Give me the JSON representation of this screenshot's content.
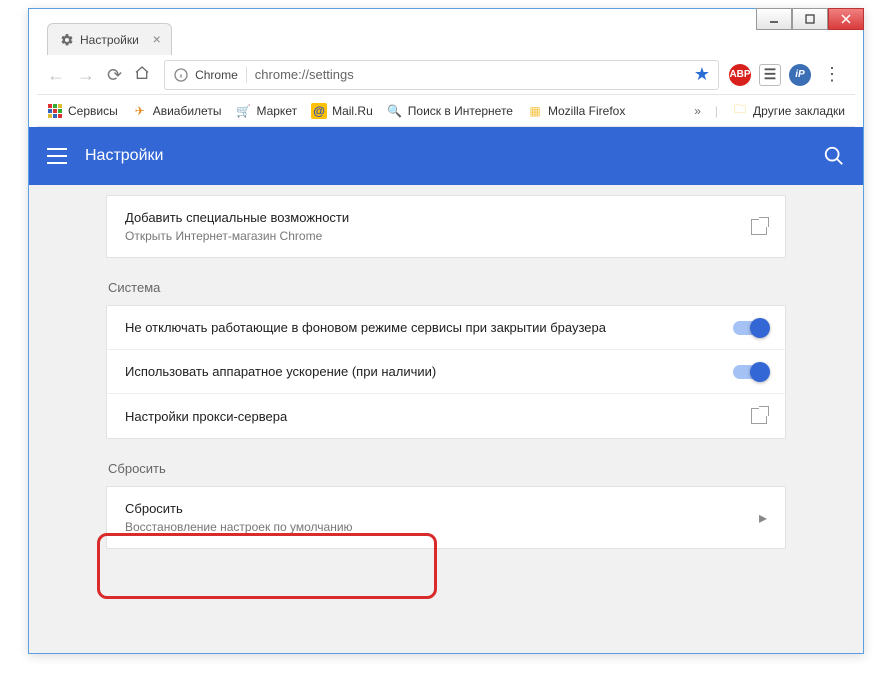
{
  "tab": {
    "title": "Настройки"
  },
  "omnibox": {
    "chip": "Chrome",
    "url": "chrome://settings"
  },
  "bookmarks": {
    "items": [
      {
        "label": "Сервисы"
      },
      {
        "label": "Авиабилеты"
      },
      {
        "label": "Маркет"
      },
      {
        "label": "Mail.Ru"
      },
      {
        "label": "Поиск в Интернете"
      },
      {
        "label": "Mozilla Firefox"
      }
    ],
    "more": "»",
    "other": "Другие закладки"
  },
  "header": {
    "title": "Настройки"
  },
  "accessibility": {
    "title": "Добавить специальные возможности",
    "sub": "Открыть Интернет-магазин Chrome"
  },
  "system": {
    "label": "Система",
    "bg_services": "Не отключать работающие в фоновом режиме сервисы при закрытии браузера",
    "hw_accel": "Использовать аппаратное ускорение (при наличии)",
    "proxy": "Настройки прокси-сервера"
  },
  "reset": {
    "label": "Сбросить",
    "title": "Сбросить",
    "sub": "Восстановление настроек по умолчанию"
  }
}
